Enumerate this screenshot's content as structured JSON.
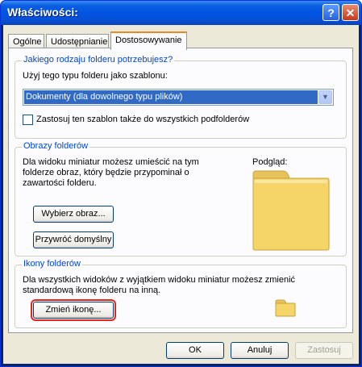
{
  "window": {
    "title": "Właściwości:",
    "help_label": "?",
    "close_label": "✕"
  },
  "tabs": [
    {
      "label": "Ogólne"
    },
    {
      "label": "Udostępnianie"
    },
    {
      "label": "Dostosowywanie"
    }
  ],
  "folder_type": {
    "legend": "Jakiego rodzaju folderu potrzebujesz?",
    "template_label": "Użyj tego typu folderu jako szablonu:",
    "selected_template": "Dokumenty (dla dowolnego typu plików)",
    "apply_to_subfolders_label": "Zastosuj ten szablon także do wszystkich podfolderów",
    "apply_to_subfolders_checked": false
  },
  "folder_pictures": {
    "legend": "Obrazy folderów",
    "description": "Dla widoku miniatur możesz umieścić na tym folderze obraz, który będzie przypominał o zawartości folderu.",
    "preview_label": "Podgląd:",
    "choose_button": "Wybierz obraz...",
    "restore_button": "Przywróć domyślny"
  },
  "folder_icons": {
    "legend": "Ikony folderów",
    "description": "Dla wszystkich widoków z wyjątkiem widoku miniatur możesz zmienić standardową ikonę folderu na inną.",
    "change_icon_button": "Zmień ikonę..."
  },
  "footer": {
    "ok": "OK",
    "cancel": "Anuluj",
    "apply": "Zastosuj"
  },
  "colors": {
    "title_bar": "#0054e3",
    "legend": "#0046d5",
    "folder": "#f6d568",
    "highlight": "#e2261c"
  }
}
